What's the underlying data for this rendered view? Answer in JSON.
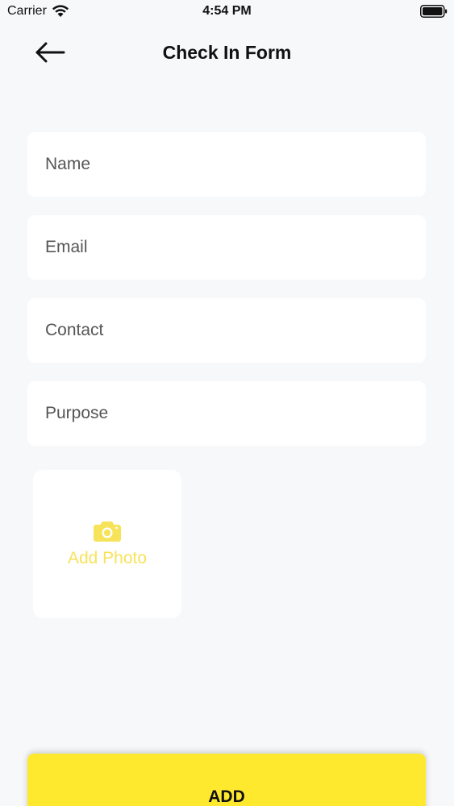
{
  "status_bar": {
    "carrier": "Carrier",
    "time": "4:54 PM"
  },
  "header": {
    "title": "Check In Form",
    "back_icon": "arrow-left-icon"
  },
  "form": {
    "fields": [
      {
        "placeholder": "Name",
        "value": ""
      },
      {
        "placeholder": "Email",
        "value": ""
      },
      {
        "placeholder": "Contact",
        "value": ""
      },
      {
        "placeholder": "Purpose",
        "value": ""
      }
    ],
    "photo": {
      "label": "Add Photo",
      "icon": "camera-icon"
    }
  },
  "actions": {
    "add_label": "ADD"
  },
  "colors": {
    "accent": "#ffe92e",
    "photo_accent": "#f7e35a",
    "background": "#f7f8fa",
    "card": "#ffffff"
  }
}
